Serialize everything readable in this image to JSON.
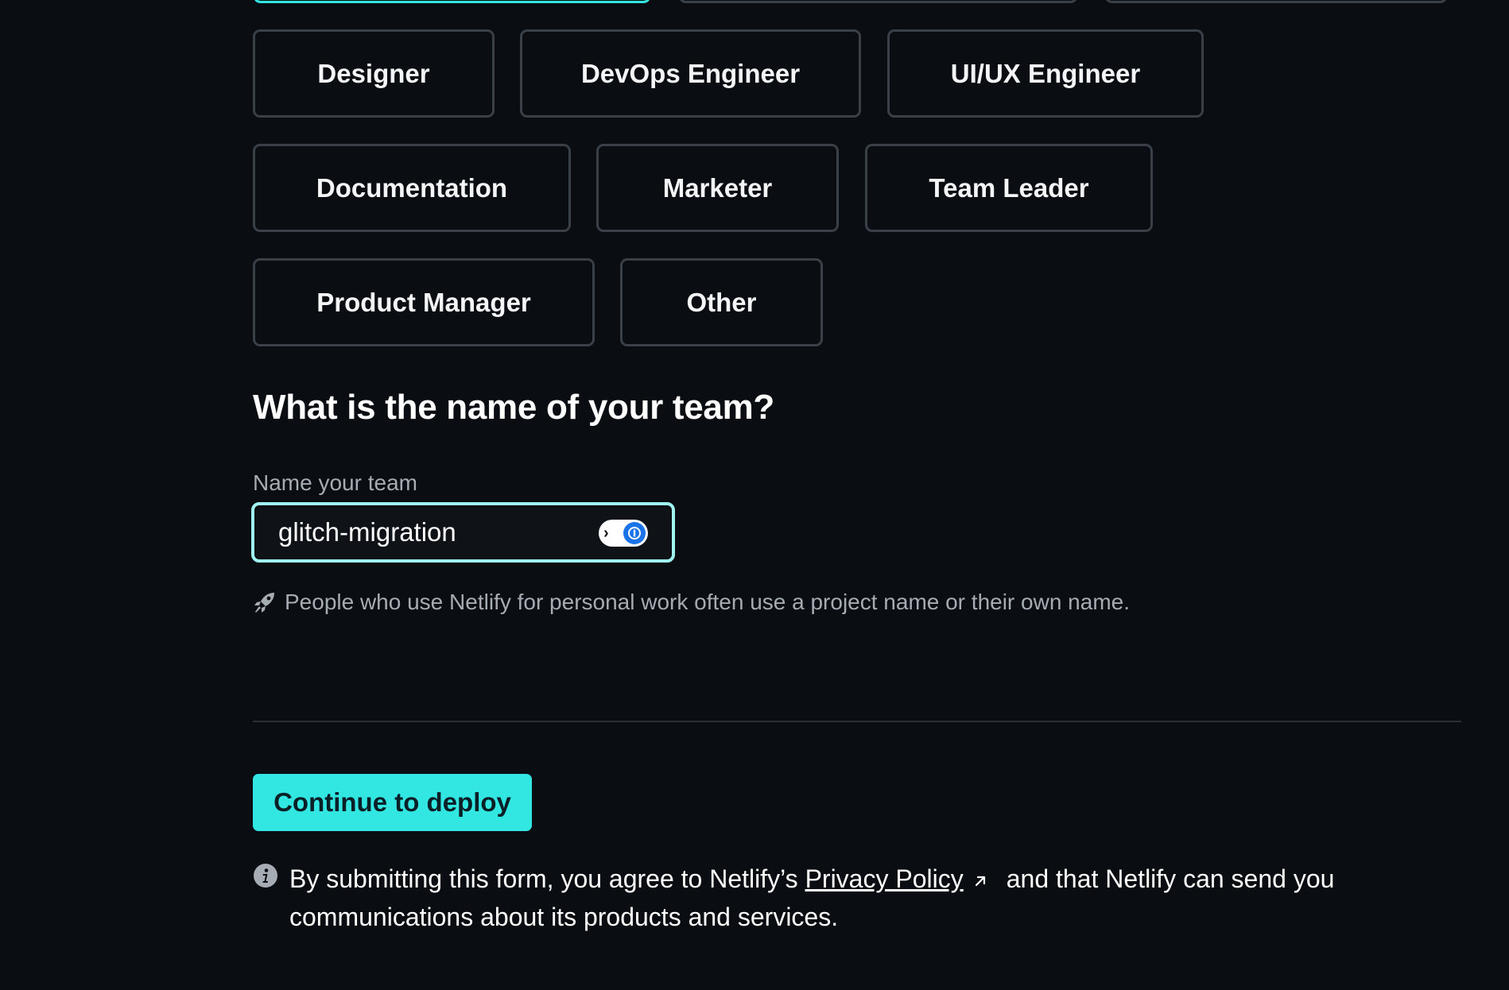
{
  "roles": {
    "items": [
      {
        "label": "Designer"
      },
      {
        "label": "DevOps Engineer"
      },
      {
        "label": "UI/UX Engineer"
      },
      {
        "label": "Documentation"
      },
      {
        "label": "Marketer"
      },
      {
        "label": "Team Leader"
      },
      {
        "label": "Product Manager"
      },
      {
        "label": "Other"
      }
    ]
  },
  "team": {
    "heading": "What is the name of your team?",
    "label": "Name your team",
    "value": "glitch-migration",
    "hint": "People who use Netlify for personal work often use a project name or their own name."
  },
  "actions": {
    "continue_label": "Continue to deploy"
  },
  "legal": {
    "before": "By submitting this form, you agree to Netlify’s",
    "link": "Privacy Policy",
    "after": "and that Netlify can send you communications about its products and services."
  },
  "colors": {
    "accent": "#32e6e2",
    "background": "#0a0e12",
    "border": "#3a4048",
    "focus_ring": "#9ff4f2",
    "muted_text": "#a6acb3"
  },
  "icons": {
    "hint": "rocket-icon",
    "legal": "info-icon",
    "link": "external-link-icon",
    "password_manager": "password-manager-icon"
  }
}
